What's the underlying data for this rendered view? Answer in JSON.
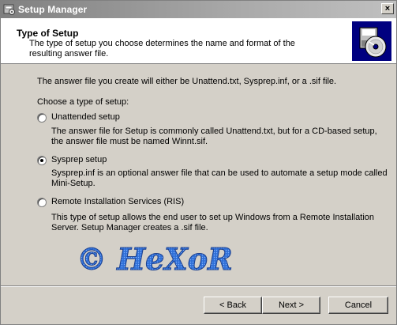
{
  "window": {
    "title": "Setup Manager",
    "close_glyph": "×"
  },
  "header": {
    "title": "Type of Setup",
    "description": "The type of setup you choose determines the name and format of the resulting answer file."
  },
  "body": {
    "intro": "The answer file you create will either be Unattend.txt, Sysprep.inf, or a .sif file.",
    "choose_label": "Choose a type of setup:",
    "options": [
      {
        "label": "Unattended setup",
        "description": "The answer file for Setup is commonly called Unattend.txt, but for a CD-based setup, the answer file must be named Winnt.sif.",
        "checked": false
      },
      {
        "label": "Sysprep setup",
        "description": "Sysprep.inf is an optional answer file that can be used to automate a setup mode called Mini-Setup.",
        "checked": true
      },
      {
        "label": "Remote Installation Services (RIS)",
        "description": "This type of setup allows the end user to set up Windows from a Remote Installation Server. Setup Manager creates a .sif file.",
        "checked": false
      }
    ]
  },
  "watermark": {
    "text": "© HeXoR"
  },
  "buttons": {
    "back": "< Back",
    "next": "Next >",
    "cancel": "Cancel"
  },
  "colors": {
    "header_art": "#000080",
    "watermark": "#2f6fd6"
  }
}
